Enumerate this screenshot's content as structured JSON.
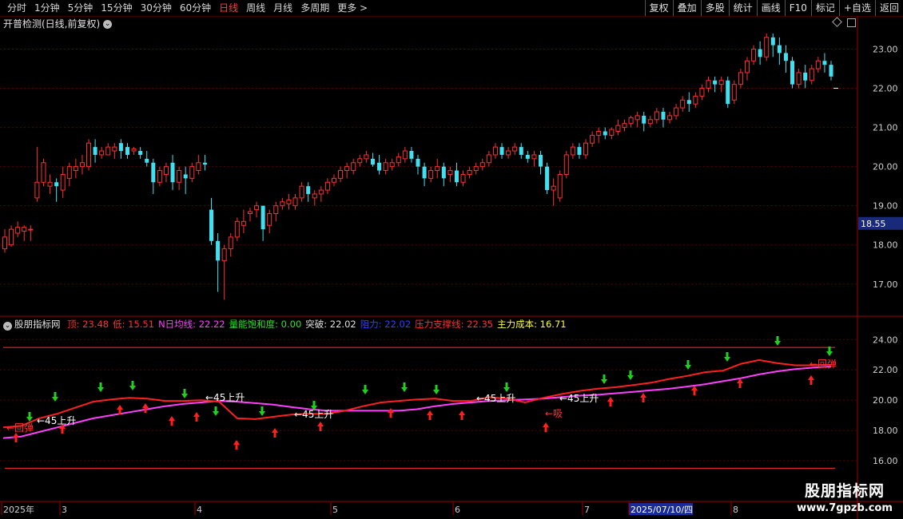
{
  "toolbar": {
    "periods": [
      "分时",
      "1分钟",
      "5分钟",
      "15分钟",
      "30分钟",
      "60分钟",
      "日线",
      "周线",
      "月线",
      "多周期",
      "更多 >"
    ],
    "active_period": "日线",
    "buttons": [
      "复权",
      "叠加",
      "多股",
      "统计",
      "画线",
      "F10",
      "+自选",
      "返回"
    ],
    "mark_button": "标记"
  },
  "main_panel": {
    "title": "开普检测(日线,前复权)",
    "price_badge": "18.55"
  },
  "indicator_panel": {
    "name": "股朋指标网",
    "fields": [
      {
        "label": "顶:",
        "value": "23.48",
        "color": "#ff3030"
      },
      {
        "label": "低:",
        "value": "15.51",
        "color": "#ff3030"
      },
      {
        "label": "N日均线:",
        "value": "22.22",
        "color": "#ff40ff"
      },
      {
        "label": "量能饱和度:",
        "value": "0.00",
        "color": "#30e030"
      },
      {
        "label": "突破:",
        "value": "22.02",
        "color": "#e0e0e0"
      },
      {
        "label": "阻力:",
        "value": "22.02",
        "color": "#3040ff"
      },
      {
        "label": "压力支撑线:",
        "value": "22.35",
        "color": "#ff3030"
      },
      {
        "label": "主力成本:",
        "value": "16.71",
        "color": "#ffff40"
      }
    ]
  },
  "xaxis": {
    "labels": [
      "2025年",
      "3",
      "4",
      "5",
      "6",
      "7",
      "2025/07/10/四",
      "8"
    ]
  },
  "watermark": {
    "line1": "股朋指标网",
    "line2": "www.7gpzb.com"
  },
  "chart_data": [
    {
      "type": "candlestick",
      "title": "开普检测(日线,前复权)",
      "y_ticks": [
        17.0,
        18.0,
        19.0,
        20.0,
        21.0,
        22.0,
        23.0
      ],
      "ylim": [
        16.2,
        23.5
      ],
      "colors": {
        "up": "#ff3030",
        "down": "#40e0f0"
      },
      "ohlc": [
        [
          17.9,
          18.4,
          18.2,
          17.8
        ],
        [
          18.0,
          18.5,
          18.4,
          17.95
        ],
        [
          18.3,
          18.6,
          18.45,
          18.2
        ],
        [
          18.35,
          18.5,
          18.45,
          18.1
        ],
        [
          18.4,
          18.5,
          18.4,
          18.1
        ],
        [
          19.2,
          20.5,
          19.6,
          19.1
        ],
        [
          19.6,
          20.2,
          20.1,
          19.5
        ],
        [
          19.5,
          19.8,
          19.6,
          19.3
        ],
        [
          19.6,
          19.7,
          19.5,
          19.1
        ],
        [
          19.4,
          20.0,
          19.8,
          19.2
        ],
        [
          19.7,
          20.1,
          20.0,
          19.5
        ],
        [
          19.9,
          20.2,
          20.0,
          19.7
        ],
        [
          20.0,
          20.3,
          20.1,
          19.8
        ],
        [
          20.0,
          20.7,
          20.6,
          19.9
        ],
        [
          20.5,
          20.7,
          20.3,
          20.1
        ],
        [
          20.3,
          20.5,
          20.4,
          20.2
        ],
        [
          20.3,
          20.6,
          20.5,
          20.3
        ],
        [
          20.4,
          20.6,
          20.5,
          20.2
        ],
        [
          20.6,
          20.7,
          20.4,
          20.2
        ],
        [
          20.5,
          20.6,
          20.3,
          20.2
        ],
        [
          20.4,
          20.5,
          20.45,
          20.3
        ],
        [
          20.4,
          20.5,
          20.3,
          20.2
        ],
        [
          20.2,
          20.4,
          20.1,
          20.0
        ],
        [
          20.1,
          20.2,
          19.6,
          19.3
        ],
        [
          19.6,
          20.0,
          19.9,
          19.5
        ],
        [
          19.8,
          20.1,
          20.0,
          19.6
        ],
        [
          20.1,
          20.3,
          19.6,
          19.4
        ],
        [
          19.6,
          20.0,
          19.9,
          19.4
        ],
        [
          19.8,
          20.0,
          19.7,
          19.3
        ],
        [
          19.7,
          20.1,
          20.0,
          19.6
        ],
        [
          19.9,
          20.3,
          20.1,
          19.8
        ],
        [
          20.1,
          20.3,
          20.05,
          19.9
        ],
        [
          18.9,
          19.2,
          18.1,
          18.0
        ],
        [
          18.1,
          18.3,
          17.6,
          16.8
        ],
        [
          17.6,
          18.0,
          17.9,
          16.6
        ],
        [
          17.9,
          18.3,
          18.2,
          17.7
        ],
        [
          18.2,
          18.7,
          18.6,
          18.1
        ],
        [
          18.5,
          18.9,
          18.6,
          18.3
        ],
        [
          18.8,
          18.95,
          18.85,
          18.6
        ],
        [
          18.9,
          19.1,
          19.0,
          18.7
        ],
        [
          19.0,
          19.0,
          18.4,
          18.1
        ],
        [
          18.5,
          18.9,
          18.8,
          18.3
        ],
        [
          18.8,
          19.1,
          19.0,
          18.6
        ],
        [
          19.0,
          19.2,
          19.1,
          18.9
        ],
        [
          19.05,
          19.3,
          19.15,
          18.9
        ],
        [
          19.0,
          19.3,
          19.2,
          18.9
        ],
        [
          19.2,
          19.6,
          19.5,
          19.1
        ],
        [
          19.5,
          19.6,
          19.3,
          19.1
        ],
        [
          19.2,
          19.4,
          19.3,
          19.0
        ],
        [
          19.3,
          19.5,
          19.4,
          19.1
        ],
        [
          19.4,
          19.7,
          19.6,
          19.3
        ],
        [
          19.6,
          19.8,
          19.7,
          19.5
        ],
        [
          19.7,
          20.0,
          19.9,
          19.6
        ],
        [
          19.9,
          20.1,
          20.0,
          19.7
        ],
        [
          19.9,
          20.2,
          20.1,
          19.8
        ],
        [
          20.1,
          20.3,
          20.2,
          20.0
        ],
        [
          20.2,
          20.4,
          20.3,
          20.1
        ],
        [
          20.2,
          20.35,
          20.05,
          20.0
        ],
        [
          20.1,
          20.3,
          19.9,
          19.8
        ],
        [
          19.9,
          20.2,
          20.1,
          19.8
        ],
        [
          20.0,
          20.2,
          20.1,
          19.9
        ],
        [
          20.1,
          20.35,
          20.25,
          20.0
        ],
        [
          20.2,
          20.5,
          20.4,
          20.1
        ],
        [
          20.4,
          20.5,
          20.2,
          20.1
        ],
        [
          20.2,
          20.3,
          20.0,
          19.8
        ],
        [
          20.0,
          20.1,
          19.7,
          19.5
        ],
        [
          19.7,
          20.0,
          19.9,
          19.6
        ],
        [
          19.9,
          20.2,
          20.0,
          19.7
        ],
        [
          20.0,
          20.1,
          19.7,
          19.5
        ],
        [
          19.8,
          20.0,
          19.9,
          19.6
        ],
        [
          19.9,
          20.1,
          19.6,
          19.5
        ],
        [
          19.6,
          19.9,
          19.8,
          19.5
        ],
        [
          19.8,
          20.0,
          19.9,
          19.7
        ],
        [
          19.9,
          20.1,
          20.0,
          19.8
        ],
        [
          20.0,
          20.2,
          20.1,
          19.9
        ],
        [
          20.1,
          20.4,
          20.3,
          20.0
        ],
        [
          20.3,
          20.6,
          20.5,
          20.2
        ],
        [
          20.5,
          20.6,
          20.3,
          20.2
        ],
        [
          20.3,
          20.5,
          20.4,
          20.2
        ],
        [
          20.4,
          20.6,
          20.5,
          20.3
        ],
        [
          20.5,
          20.6,
          20.3,
          20.2
        ],
        [
          20.3,
          20.4,
          20.2,
          20.1
        ],
        [
          20.2,
          20.4,
          20.3,
          20.0
        ],
        [
          20.3,
          20.4,
          20.0,
          19.8
        ],
        [
          20.0,
          20.1,
          19.4,
          19.3
        ],
        [
          19.4,
          19.7,
          19.5,
          19.0
        ],
        [
          19.2,
          19.9,
          19.8,
          19.1
        ],
        [
          19.8,
          20.4,
          20.3,
          19.7
        ],
        [
          20.3,
          20.6,
          20.5,
          20.2
        ],
        [
          20.5,
          20.6,
          20.3,
          20.2
        ],
        [
          20.3,
          20.7,
          20.6,
          20.2
        ],
        [
          20.6,
          20.9,
          20.8,
          20.5
        ],
        [
          20.8,
          21.0,
          20.9,
          20.6
        ],
        [
          20.9,
          21.0,
          20.8,
          20.7
        ],
        [
          20.8,
          21.0,
          20.95,
          20.7
        ],
        [
          20.9,
          21.2,
          21.05,
          20.8
        ],
        [
          21.0,
          21.2,
          21.1,
          20.9
        ],
        [
          21.1,
          21.3,
          21.25,
          21.0
        ],
        [
          21.2,
          21.4,
          21.3,
          21.0
        ],
        [
          21.3,
          21.4,
          21.1,
          20.9
        ],
        [
          21.1,
          21.3,
          21.2,
          21.0
        ],
        [
          21.2,
          21.5,
          21.4,
          21.1
        ],
        [
          21.4,
          21.5,
          21.2,
          21.0
        ],
        [
          21.2,
          21.4,
          21.3,
          21.1
        ],
        [
          21.3,
          21.6,
          21.5,
          21.2
        ],
        [
          21.5,
          21.8,
          21.7,
          21.4
        ],
        [
          21.7,
          21.9,
          21.6,
          21.4
        ],
        [
          21.6,
          21.9,
          21.8,
          21.5
        ],
        [
          21.8,
          22.1,
          22.0,
          21.7
        ],
        [
          22.0,
          22.3,
          22.2,
          21.9
        ],
        [
          22.2,
          22.3,
          22.1,
          21.9
        ],
        [
          22.1,
          22.3,
          22.2,
          21.9
        ],
        [
          22.2,
          22.3,
          21.6,
          21.5
        ],
        [
          21.7,
          22.2,
          22.1,
          21.6
        ],
        [
          22.1,
          22.5,
          22.4,
          22.0
        ],
        [
          22.4,
          22.8,
          22.7,
          22.2
        ],
        [
          22.7,
          23.1,
          23.0,
          22.6
        ],
        [
          23.0,
          23.2,
          22.8,
          22.6
        ],
        [
          22.8,
          23.4,
          23.3,
          22.7
        ],
        [
          23.3,
          23.4,
          23.1,
          22.8
        ],
        [
          23.1,
          23.3,
          22.9,
          22.6
        ],
        [
          22.9,
          23.1,
          22.7,
          22.4
        ],
        [
          22.7,
          22.8,
          22.1,
          22.0
        ],
        [
          22.1,
          22.5,
          22.4,
          22.0
        ],
        [
          22.4,
          22.6,
          22.2,
          22.0
        ],
        [
          22.2,
          22.6,
          22.5,
          22.1
        ],
        [
          22.5,
          22.8,
          22.7,
          22.4
        ],
        [
          22.7,
          22.9,
          22.6,
          22.4
        ],
        [
          22.6,
          22.7,
          22.3,
          22.2
        ]
      ]
    },
    {
      "type": "line",
      "name": "股朋指标网",
      "y_ticks": [
        16.0,
        18.0,
        20.0,
        22.0,
        24.0
      ],
      "ylim": [
        15.0,
        24.7
      ],
      "hlines": [
        {
          "value": 23.48,
          "color": "#ff3030"
        },
        {
          "value": 15.51,
          "color": "#ff3030"
        }
      ],
      "series": [
        {
          "name": "N日均线",
          "color": "#ff40ff",
          "values": [
            17.5,
            17.6,
            17.9,
            18.2,
            18.5,
            18.8,
            19.0,
            19.2,
            19.4,
            19.6,
            19.75,
            19.85,
            19.95,
            19.9,
            19.8,
            19.7,
            19.55,
            19.4,
            19.3,
            19.3,
            19.3,
            19.3,
            19.3,
            19.4,
            19.6,
            19.75,
            19.85,
            19.95,
            20.0,
            20.05,
            20.1,
            20.2,
            20.3,
            20.35,
            20.45,
            20.55,
            20.65,
            20.75,
            20.9,
            21.05,
            21.25,
            21.45,
            21.7,
            21.9,
            22.05,
            22.15,
            22.22
          ]
        },
        {
          "name": "压力支撑线",
          "color": "#ff2020",
          "values": [
            18.2,
            18.3,
            18.8,
            19.1,
            19.5,
            19.9,
            20.05,
            20.15,
            20.1,
            19.95,
            19.95,
            20.0,
            19.9,
            18.8,
            18.75,
            18.9,
            19.05,
            19.1,
            19.1,
            19.3,
            19.6,
            19.85,
            19.95,
            20.05,
            20.1,
            19.95,
            19.95,
            20.2,
            20.1,
            19.85,
            20.15,
            20.4,
            20.6,
            20.75,
            20.85,
            21.0,
            21.15,
            21.4,
            21.6,
            21.85,
            21.95,
            22.4,
            22.65,
            22.45,
            22.3,
            22.3,
            22.35
          ]
        }
      ],
      "labels": [
        {
          "text": "←回弹"
        },
        {
          "text": "←45上升"
        },
        {
          "text": "←45上升"
        },
        {
          "text": "←45上升"
        },
        {
          "text": "←45上升"
        },
        {
          "text": "←吸"
        },
        {
          "text": "←回弹"
        }
      ]
    }
  ]
}
